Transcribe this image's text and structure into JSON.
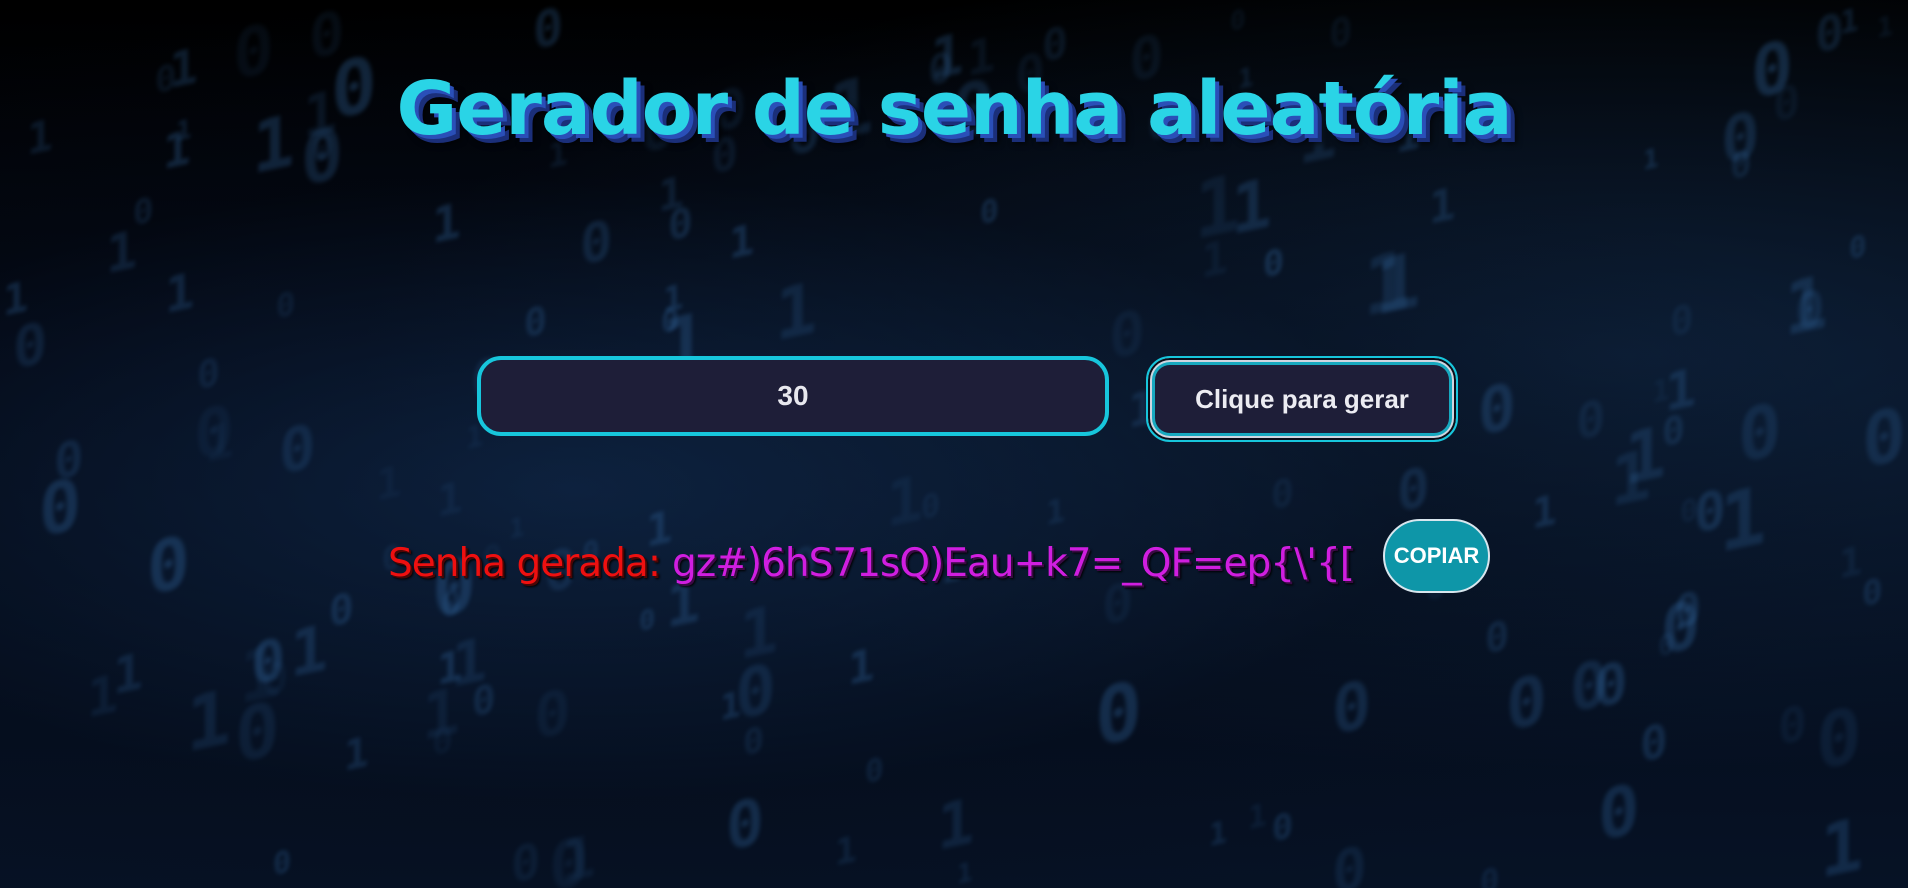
{
  "page": {
    "title": "Gerador de senha aleatória"
  },
  "generator": {
    "length_value": "30",
    "generate_button_label": "Clique para gerar"
  },
  "result": {
    "label": "Senha gerada:",
    "password": "gz#)6hS71sQ)Eau+k7=_QF=ep{\\'{[",
    "copy_button_label": "COPIAR"
  },
  "colors": {
    "title": "#2ad4e6",
    "input_border": "#17c6dc",
    "result_label": "#ee1010",
    "result_value": "#d01ee0",
    "copy_button_bg": "#0e96a8"
  }
}
